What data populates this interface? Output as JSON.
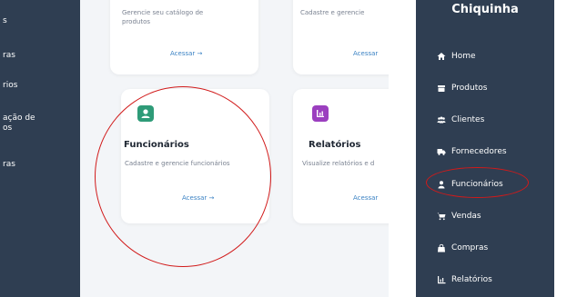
{
  "left_sidebar": {
    "items": [
      "s",
      "ras",
      "rios",
      "ação de",
      "os",
      "ras"
    ]
  },
  "cards": {
    "produtos": {
      "desc_line1": "Gerencie seu catálogo de",
      "desc_line2": "produtos",
      "link": "Acessar →"
    },
    "fornecedores": {
      "desc": "Cadastre e gerencie",
      "link": "Acessar"
    },
    "funcionarios": {
      "title": "Funcionários",
      "desc": "Cadastre e gerencie funcionários",
      "link": "Acessar →",
      "icon": "user-icon",
      "icon_color": "#2e9b78"
    },
    "relatorios": {
      "title": "Relatórios",
      "desc": "Visualize relatórios e d",
      "link": "Acessar",
      "icon": "chart-icon",
      "icon_color": "#9b3fbf"
    }
  },
  "right_sidebar": {
    "brand": "Chiquinha",
    "items": [
      {
        "label": "Home",
        "icon": "home-icon"
      },
      {
        "label": "Produtos",
        "icon": "box-icon"
      },
      {
        "label": "Clientes",
        "icon": "users-icon"
      },
      {
        "label": "Fornecedores",
        "icon": "truck-icon"
      },
      {
        "label": "Funcionários",
        "icon": "user-icon"
      },
      {
        "label": "Vendas",
        "icon": "cart-icon"
      },
      {
        "label": "Compras",
        "icon": "bag-icon"
      },
      {
        "label": "Relatórios",
        "icon": "chart-icon"
      }
    ]
  },
  "colors": {
    "sidebar_bg": "#2f3e52",
    "annotation": "#d11a1a",
    "link": "#3b82c4"
  }
}
